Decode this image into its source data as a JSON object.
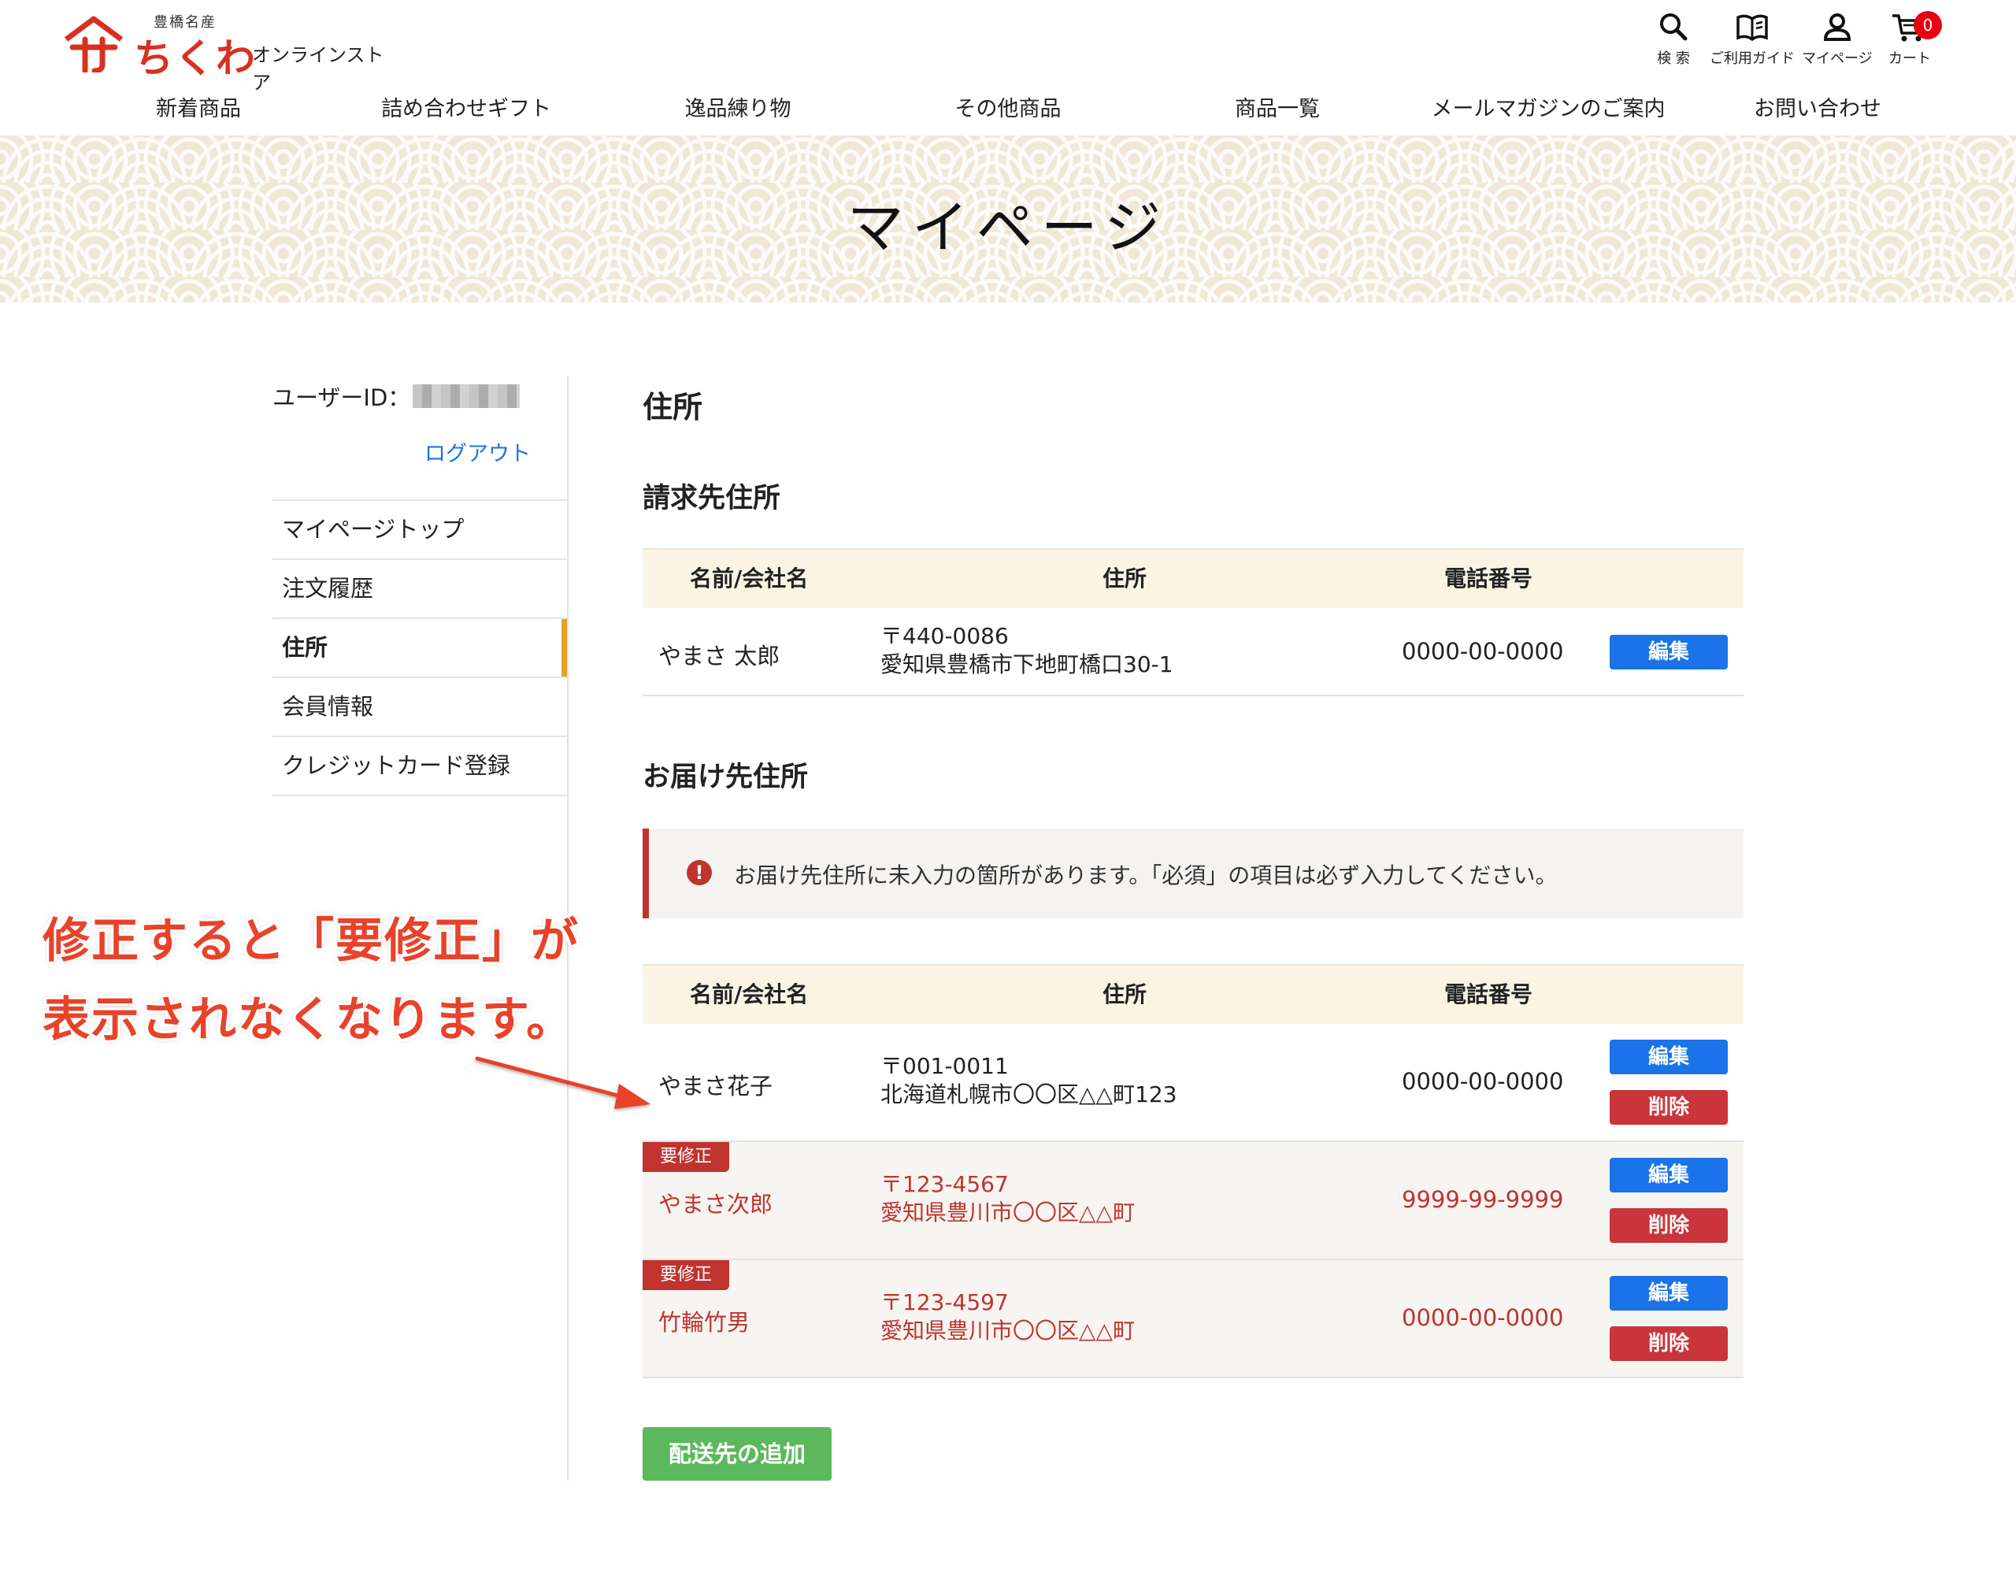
{
  "header": {
    "logo_small": "豊橋名産",
    "logo_main": "ちくわ",
    "logo_sub": "オンラインストア",
    "utils": [
      {
        "label": "検 索",
        "icon": "search-icon"
      },
      {
        "label": "ご利用ガイド",
        "icon": "book-icon"
      },
      {
        "label": "マイページ",
        "icon": "user-icon"
      },
      {
        "label": "カート",
        "icon": "cart-icon"
      }
    ],
    "cart_count": "0",
    "nav": [
      "新着商品",
      "詰め合わせギフト",
      "逸品練り物",
      "その他商品",
      "商品一覧",
      "メールマガジンのご案内",
      "お問い合わせ"
    ]
  },
  "banner": {
    "title": "マイページ"
  },
  "sidebar": {
    "userid_label": "ユーザーID：",
    "logout": "ログアウト",
    "menu": [
      "マイページトップ",
      "注文履歴",
      "住所",
      "会員情報",
      "クレジットカード登録"
    ],
    "active_index": 2
  },
  "main": {
    "page_title": "住所",
    "billing_title": "請求先住所",
    "shipping_title": "お届け先住所",
    "columns": {
      "name": "名前/会社名",
      "address": "住所",
      "tel": "電話番号"
    },
    "billing": {
      "name": "やまさ 太郎",
      "zip": "〒440-0086",
      "addr": "愛知県豊橋市下地町橋口30-1",
      "tel": "0000-00-0000",
      "edit": "編集"
    },
    "alert": "お届け先住所に未入力の箇所があります。「必須」の項目は必ず入力してください。",
    "shipping": [
      {
        "badge": "",
        "name": "やまさ花子",
        "zip": "〒001-0011",
        "addr": "北海道札幌市〇〇区△△町123",
        "tel": "0000-00-0000",
        "edit": "編集",
        "delete": "削除"
      },
      {
        "badge": "要修正",
        "name": "やまさ次郎",
        "zip": "〒123-4567",
        "addr": "愛知県豊川市〇〇区△△町",
        "tel": "9999-99-9999",
        "edit": "編集",
        "delete": "削除"
      },
      {
        "badge": "要修正",
        "name": "竹輪竹男",
        "zip": "〒123-4597",
        "addr": "愛知県豊川市〇〇区△△町",
        "tel": "0000-00-0000",
        "edit": "編集",
        "delete": "削除"
      }
    ],
    "add_button": "配送先の追加"
  },
  "annotation": {
    "line1": "修正すると「要修正」が",
    "line2": "表示されなくなります。"
  },
  "colors": {
    "brand_red": "#d8311f",
    "link_blue": "#1a73e8",
    "edit_blue": "#1a73e8",
    "delete_red": "#c9353a",
    "warn_red": "#c0332f",
    "add_green": "#5cb85c",
    "active_bar": "#e0a52a",
    "annotation": "#e8432a"
  }
}
